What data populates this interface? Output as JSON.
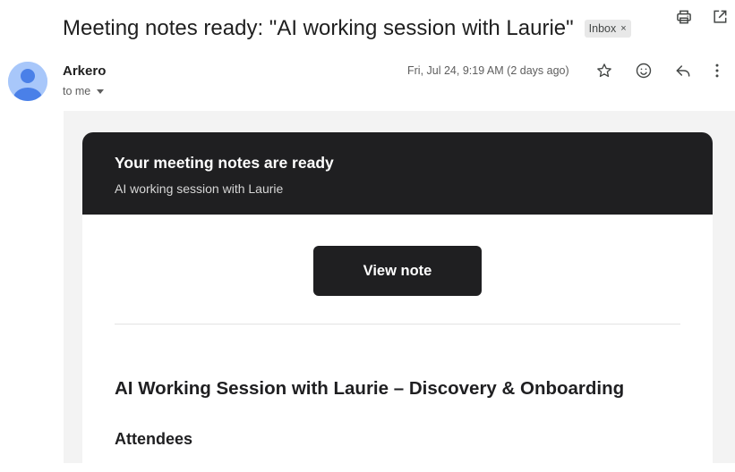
{
  "email": {
    "subject": "Meeting notes ready: \"AI working session with Laurie\"",
    "label": "Inbox",
    "label_close": "×",
    "sender": "Arkero",
    "recipient": "to me",
    "date": "Fri, Jul 24, 9:19 AM (2 days ago)"
  },
  "icons": {
    "print": "print-icon",
    "open_new_window": "open-in-new-icon",
    "star": "star-icon",
    "emoji": "emoji-icon",
    "reply": "reply-icon",
    "more": "more-vert-icon",
    "avatar": "person-icon"
  },
  "body": {
    "header_title": "Your meeting notes are ready",
    "header_subtitle": "AI working session with Laurie",
    "button_label": "View note",
    "note_title": "AI Working Session with Laurie – Discovery & Onboarding",
    "section_attendees": "Attendees"
  },
  "colors": {
    "card_header_bg": "#1f1f21",
    "email_bg": "#f3f3f3",
    "avatar_bg": "#a8c7fa",
    "avatar_fg": "#4a80e8"
  }
}
